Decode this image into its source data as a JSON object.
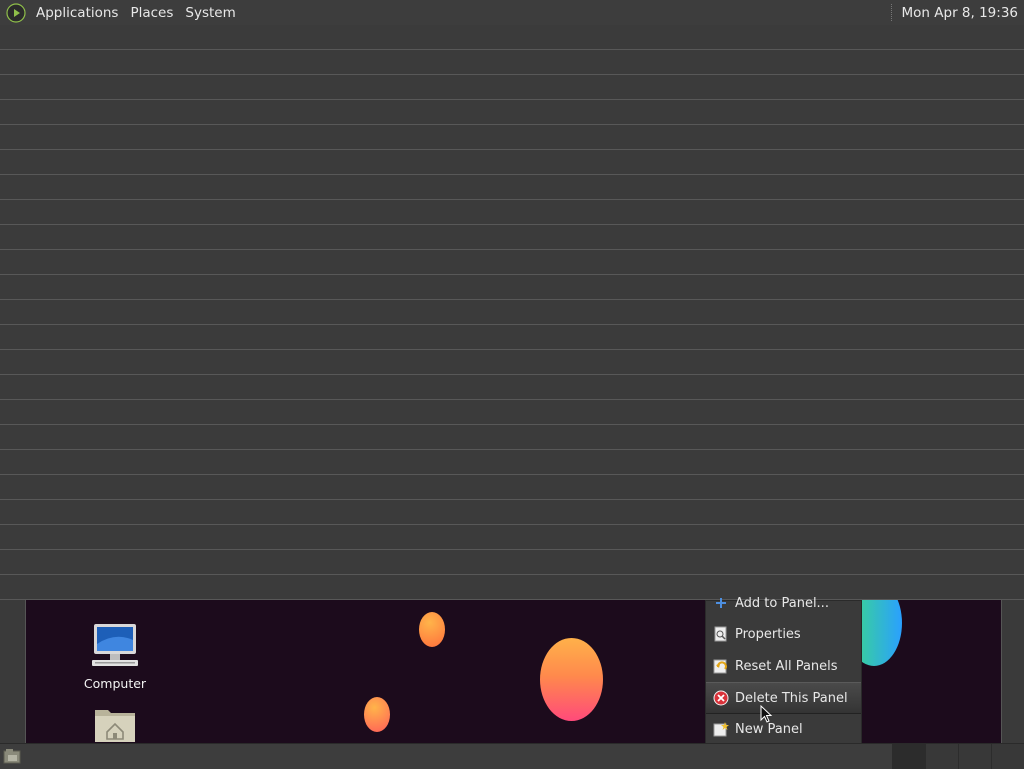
{
  "top_panel": {
    "menus": [
      "Applications",
      "Places",
      "System"
    ],
    "clock": "Mon Apr  8, 19:36"
  },
  "desktop": {
    "icons": [
      {
        "label": "Computer",
        "icon": "computer-icon"
      },
      {
        "label": "",
        "icon": "home-folder-icon"
      }
    ]
  },
  "context_menu": {
    "items": [
      {
        "label": "Add to Panel...",
        "icon": "add-icon"
      },
      {
        "label": "Properties",
        "icon": "properties-icon"
      },
      {
        "label": "Reset All Panels",
        "icon": "reset-icon"
      },
      {
        "label": "Delete This Panel",
        "icon": "delete-icon",
        "selected": true
      },
      {
        "label": "New Panel",
        "icon": "new-panel-icon"
      }
    ]
  },
  "bottom_panel": {
    "workspace_count": 4,
    "active_workspace": 1
  },
  "colors": {
    "panel_bg": "#3d3d3d",
    "desktop_bg": "#1c0b1c",
    "delete_red": "#d9323a"
  }
}
